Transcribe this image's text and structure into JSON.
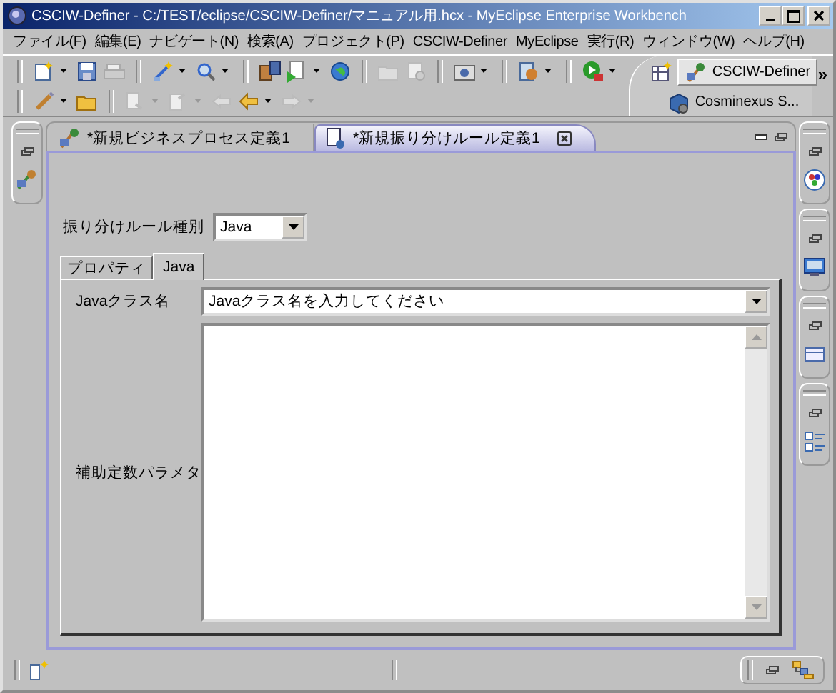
{
  "window": {
    "title": "CSCIW-Definer - C:/TEST/eclipse/CSCIW-Definer/マニュアル用.hcx - MyEclipse Enterprise Workbench"
  },
  "menu": [
    "ファイル(F)",
    "編集(E)",
    "ナビゲート(N)",
    "検索(A)",
    "プロジェクト(P)",
    "CSCIW-Definer",
    "MyEclipse",
    "実行(R)",
    "ウィンドウ(W)",
    "ヘルプ(H)"
  ],
  "perspectives": [
    {
      "label": "CSCIW-Definer",
      "selected": true
    },
    {
      "label": "Cosminexus S...",
      "selected": false
    }
  ],
  "perspective_overflow": "»",
  "editor_tabs": [
    {
      "label": "*新規ビジネスプロセス定義1",
      "selected": false
    },
    {
      "label": "*新規振り分けルール定義1",
      "selected": true
    }
  ],
  "rule_type": {
    "label": "振り分けルール種別",
    "value": "Java"
  },
  "inner_tabs": [
    {
      "label": "プロパティ",
      "selected": false
    },
    {
      "label": "Java",
      "selected": true
    }
  ],
  "class_name": {
    "label": "Javaクラス名",
    "value": "Javaクラス名を入力してください"
  },
  "parameters": {
    "label": "補助定数パラメタ"
  }
}
